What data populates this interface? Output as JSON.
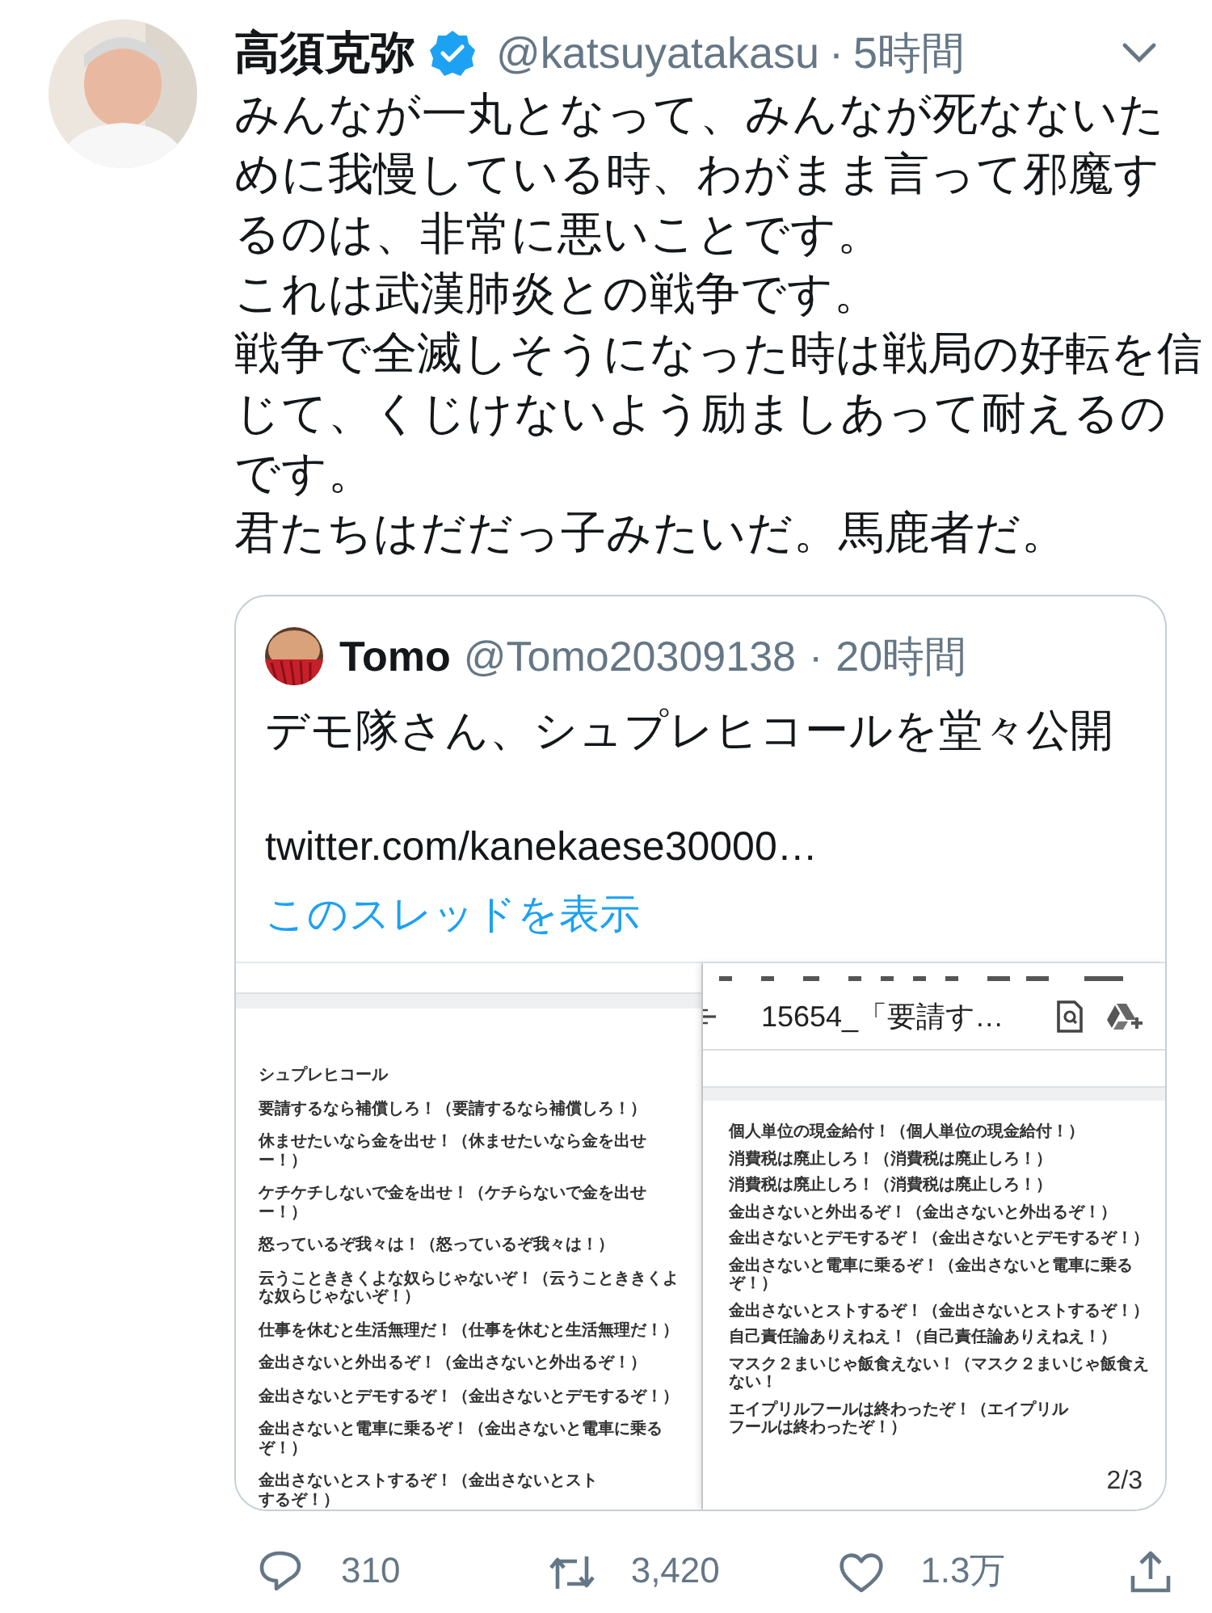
{
  "tweet": {
    "author": {
      "name": "高須克弥",
      "verified": true,
      "handle": "@katsuyatakasu",
      "separator": "·",
      "time": "5時間"
    },
    "paragraphs": [
      "みんなが一丸となって、みんなが死なないために我慢している時、わがまま言って邪魔するのは、非常に悪いことです。",
      "これは武漢肺炎との戦争です。",
      "戦争で全滅しそうになった時は戦局の好転を信じて、くじけないよう励ましあって耐えるのです。",
      "君たちはだだっ子みたいだ。馬鹿者だ。"
    ],
    "quoted_tweet": {
      "author": {
        "name": "Tomo",
        "handle": "@Tomo20309138",
        "separator": "·",
        "time": "20時間"
      },
      "text": "デモ隊さん、シュプレヒコールを堂々公開",
      "link": "twitter.com/kanekaese30000…",
      "show_thread": "このスレッドを表示",
      "documents": [
        {
          "kind": "page",
          "lines": [
            "シュプレヒコール",
            "要請するなら補償しろ！（要請するなら補償しろ！）",
            "休ませたいなら金を出せ！（休ませたいなら金を出せー！）",
            "ケチケチしないで金を出せ！（ケチらないで金を出せー！）",
            "怒っているぞ我々は！（怒っているぞ我々は！）",
            "云うことききくよな奴らじゃないぞ！（云うことききくよな奴らじゃないぞ！）",
            "仕事を休むと生活無理だ！（仕事を休むと生活無理だ！）",
            "金出さないと外出るぞ！（金出さないと外出るぞ！）",
            "金出さないとデモするぞ！（金出さないとデモするぞ！）",
            "金出さないと電車に乗るぞ！（金出さないと電車に乗るぞ！）",
            "金出さないとストするぞ！（金出さないとストするぞ！）"
          ]
        },
        {
          "kind": "viewer",
          "title": "15654_「要請す…",
          "page_indicator": "2/3",
          "lines": [
            "個人単位の現金給付！（個人単位の現金給付！）",
            "消費税は廃止しろ！（消費税は廃止しろ！）",
            "消費税は廃止しろ！（消費税は廃止しろ！）",
            "金出さないと外出るぞ！（金出さないと外出るぞ！）",
            "金出さないとデモするぞ！（金出さないとデモするぞ！）",
            "金出さないと電車に乗るぞ！（金出さないと電車に乗るぞ！）",
            "金出さないとストするぞ！（金出さないとストするぞ！）",
            "自己責任論ありえねえ！（自己責任論ありえねえ！）",
            "マスク２まいじゃ飯食えない！（マスク２まいじゃ飯食えない！",
            "エイプリルフールは終わったぞ！（エイプリルフールは終わったぞ！）"
          ]
        }
      ]
    },
    "actions": [
      {
        "kind": "reply",
        "count": "310"
      },
      {
        "kind": "retweet",
        "count": "3,420"
      },
      {
        "kind": "like",
        "count": "1.3万"
      },
      {
        "kind": "share"
      }
    ]
  }
}
